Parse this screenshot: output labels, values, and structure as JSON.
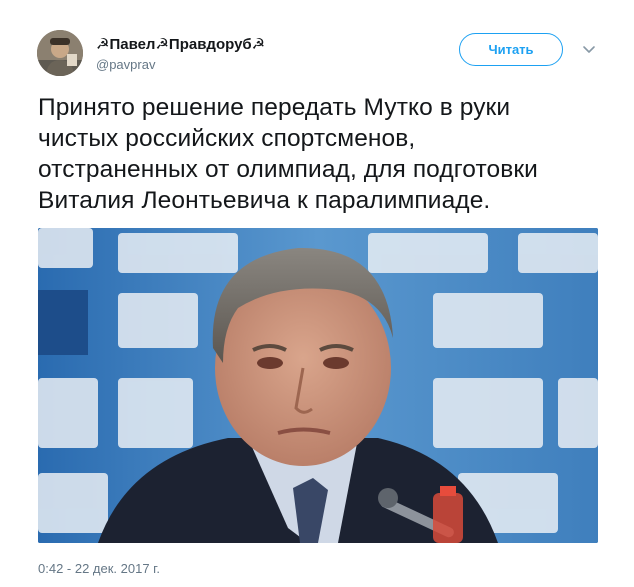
{
  "author": {
    "display_name": "☭Павел☭Правдоруб☭",
    "handle": "@pavprav"
  },
  "follow_button": {
    "label": "Читать"
  },
  "more_menu": {
    "icon": "chevron-down-icon"
  },
  "tweet": {
    "lines": [
      "Принято решение передать Мутко в руки",
      "чистых российских спортсменов,",
      "отстраненных от олимпиад, для подготовки",
      "Виталия Леонтьевича к паралимпиаде."
    ]
  },
  "media": {
    "description_icon": "photo"
  },
  "timestamp": "0:42 - 22 дек. 2017 г.",
  "colors": {
    "accent": "#1da1f2",
    "text": "#14171a",
    "muted": "#657786"
  }
}
